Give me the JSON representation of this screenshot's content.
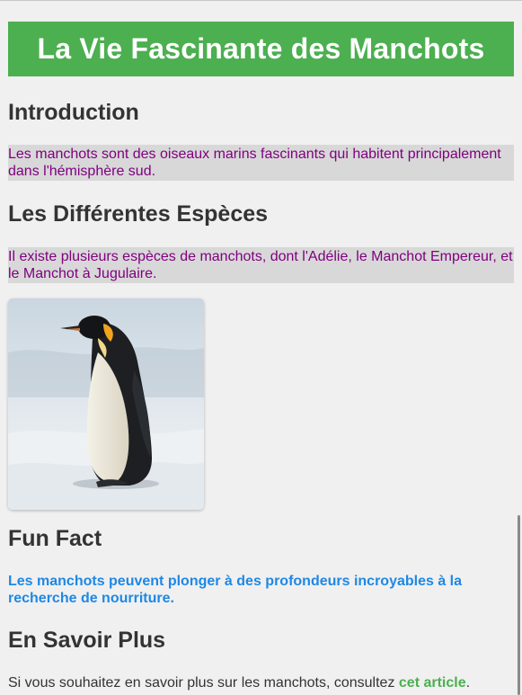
{
  "header": {
    "title": "La Vie Fascinante des Manchots"
  },
  "sections": {
    "intro": {
      "heading": "Introduction",
      "text": "Les manchots sont des oiseaux marins fascinants qui habitent principalement dans l'hémisphère sud."
    },
    "species": {
      "heading": "Les Différentes Espèces",
      "text": "Il existe plusieurs espèces de manchots, dont l'Adélie, le Manchot Empereur, et le Manchot à Jugulaire."
    },
    "fun_fact": {
      "heading": "Fun Fact",
      "text": "Les manchots peuvent plonger à des profondeurs incroyables à la recherche de nourriture."
    },
    "more": {
      "heading": "En Savoir Plus",
      "text_before": "Si vous souhaitez en savoir plus sur les manchots, consultez ",
      "link": "cet article",
      "text_after": "."
    }
  },
  "colors": {
    "banner": "#4caf50",
    "shaded_text": "#800080",
    "fun_fact_text": "#1e88e5",
    "link": "#4caf50"
  }
}
